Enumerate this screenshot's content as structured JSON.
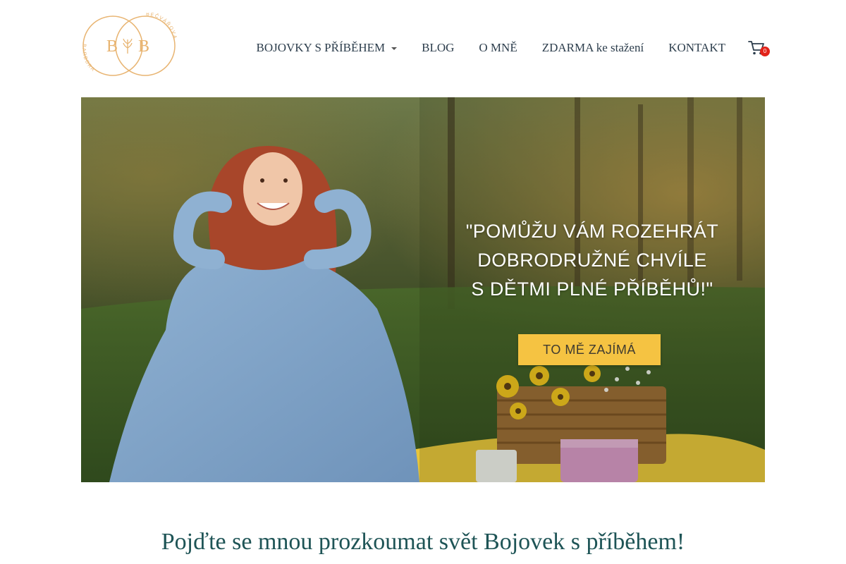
{
  "brand": {
    "logo_initials": "B B",
    "logo_ring_text_top": "BEČVÁŘOVÁ",
    "logo_ring_text_left": "BARBORA",
    "logo_color": "#e8b471"
  },
  "nav": {
    "items": [
      {
        "label": "BOJOVKY S PŘÍBĚHEM",
        "has_dropdown": true
      },
      {
        "label": "BLOG"
      },
      {
        "label": "O MNĚ"
      },
      {
        "label": "ZDARMA ke stažení"
      },
      {
        "label": "KONTAKT"
      }
    ],
    "cart": {
      "icon": "cart-icon",
      "count": "0"
    },
    "text_color": "#2c3d4c"
  },
  "hero": {
    "quote_lines": [
      "\"POMŮŽU VÁM ROZEHRÁT",
      "DOBRODRUŽNÉ CHVÍLE",
      "S DĚTMI PLNÉ PŘÍBĚHŮ!\""
    ],
    "cta_label": "TO MĚ ZAJÍMÁ",
    "cta_color": "#f5c342"
  },
  "section": {
    "title": "Pojďte se mnou prozkoumat svět Bojovek s příběhem!",
    "title_color": "#1e5456"
  }
}
